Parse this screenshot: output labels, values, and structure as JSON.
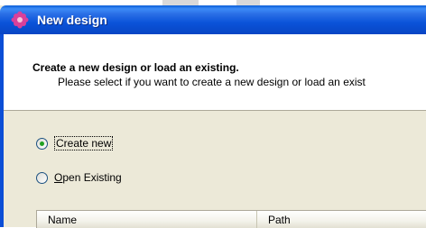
{
  "window": {
    "title": "New design",
    "icon": "app-flower-icon"
  },
  "header": {
    "title": "Create a new design or load an existing.",
    "subtitle": "Please select if you want to create a new design or load an exist"
  },
  "options": {
    "create_new": {
      "label": "Create new",
      "selected": true
    },
    "open_existing": {
      "label": "Open Existing",
      "mnemonic": "O",
      "rest": "pen Existing",
      "selected": false
    }
  },
  "list": {
    "columns": [
      "Name",
      "Path"
    ]
  },
  "colors": {
    "titlebar": "#0a53d9",
    "dialog_bg": "#ece9d8",
    "radio_dot": "#21a121"
  }
}
